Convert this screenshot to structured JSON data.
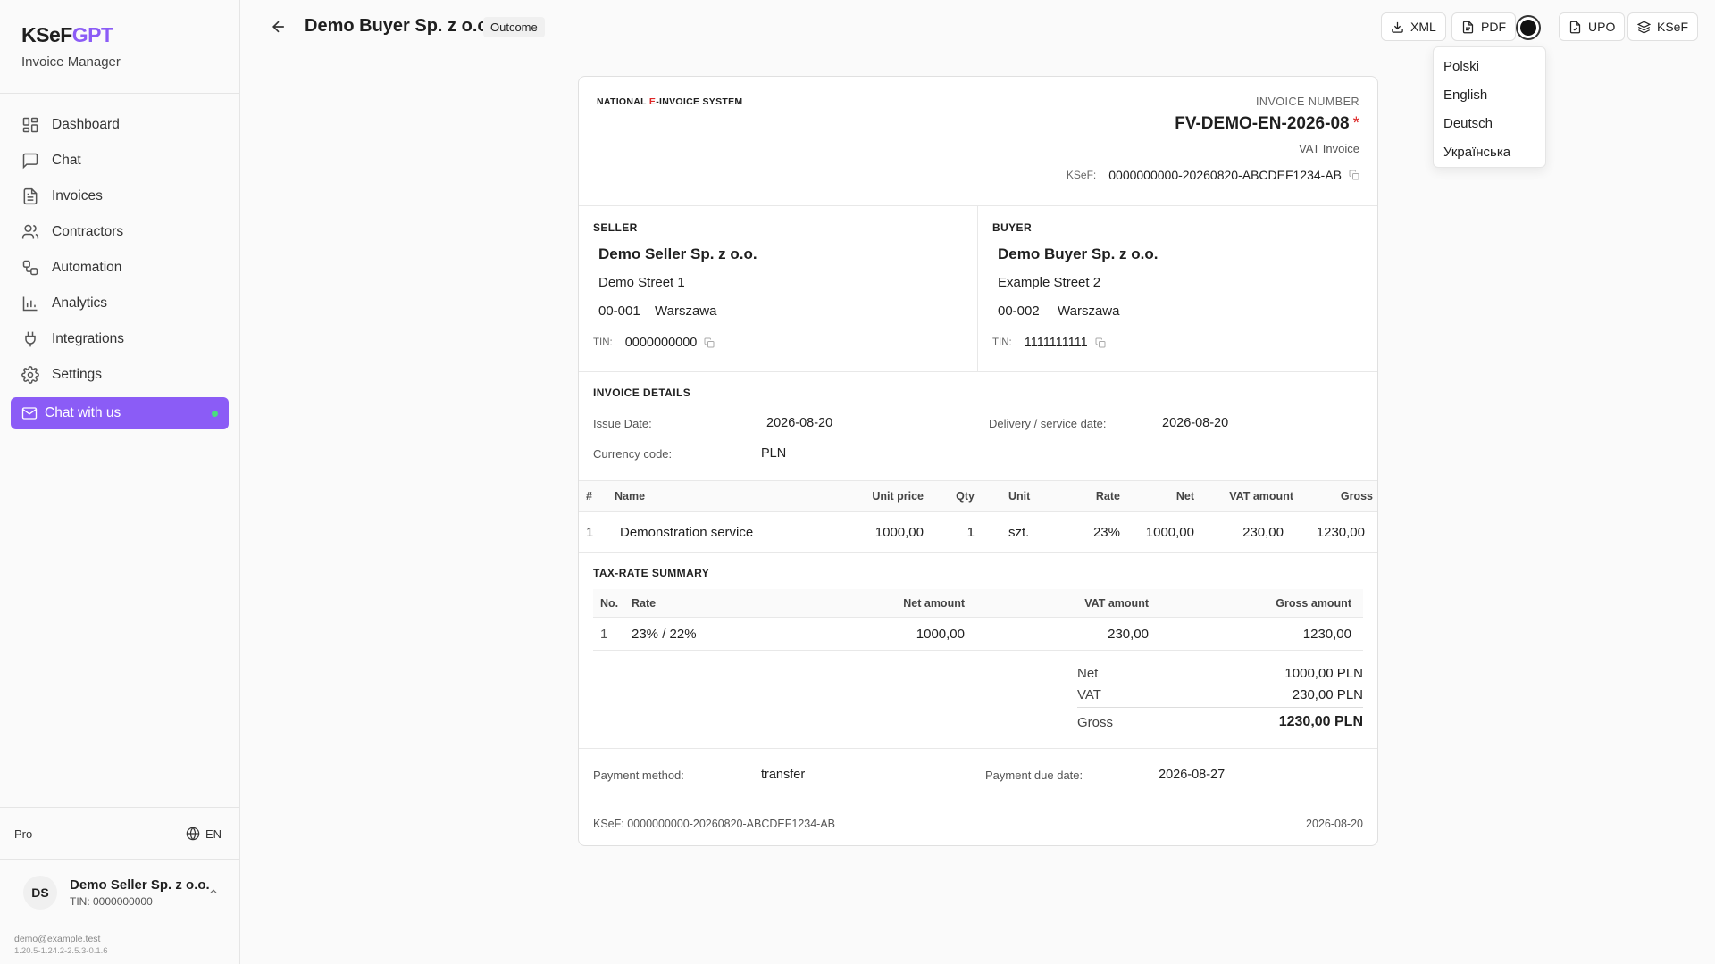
{
  "app": {
    "brand_main": "KSeF",
    "brand_accent": "GPT",
    "subtitle": "Invoice Manager"
  },
  "sidebar": {
    "items": [
      {
        "label": "Dashboard",
        "icon": "dashboard-icon"
      },
      {
        "label": "Chat",
        "icon": "chat-icon"
      },
      {
        "label": "Invoices",
        "icon": "invoice-icon"
      },
      {
        "label": "Contractors",
        "icon": "users-icon"
      },
      {
        "label": "Automation",
        "icon": "workflow-icon"
      },
      {
        "label": "Analytics",
        "icon": "bar-chart-icon"
      },
      {
        "label": "Integrations",
        "icon": "plug-icon"
      },
      {
        "label": "Settings",
        "icon": "gear-icon"
      }
    ],
    "chat_with_us": "Chat with us",
    "plan": "Pro",
    "language": "EN",
    "user": {
      "initials": "DS",
      "name": "Demo Seller Sp. z o.o.",
      "tin": "TIN: 0000000000"
    },
    "email": "demo@example.test",
    "version": "1.20.5-1.24.2-2.5.3-0.1.6"
  },
  "header": {
    "title": "Demo Buyer Sp. z o.o.",
    "badge": "Outcome",
    "buttons": {
      "xml": "XML",
      "pdf": "PDF",
      "upo": "UPO",
      "ksef": "KSeF"
    }
  },
  "language_menu": [
    "Polski",
    "English",
    "Deutsch",
    "Українська"
  ],
  "invoice": {
    "system_pre": "NATIONAL ",
    "system_red": "E",
    "system_post": "-INVOICE SYSTEM",
    "number_label": "INVOICE NUMBER",
    "number": "FV-DEMO-EN-2026-08",
    "required_mark": "*",
    "type": "VAT Invoice",
    "ksef_label": "KSeF:",
    "ksef_number": "0000000000-20260820-ABCDEF1234-AB",
    "seller": {
      "label": "SELLER",
      "name": "Demo Seller Sp. z o.o.",
      "street": "Demo Street 1",
      "postal": "00-001",
      "city": "Warszawa",
      "tin_label": "TIN:",
      "tin": "0000000000"
    },
    "buyer": {
      "label": "BUYER",
      "name": "Demo Buyer Sp. z o.o.",
      "street": "Example Street 2",
      "postal": "00-002",
      "city": "Warszawa",
      "tin_label": "TIN:",
      "tin": "1111111111"
    },
    "details": {
      "label": "INVOICE DETAILS",
      "issue_date_label": "Issue Date:",
      "issue_date": "2026-08-20",
      "delivery_label": "Delivery / service date:",
      "delivery_date": "2026-08-20",
      "currency_label": "Currency code:",
      "currency": "PLN"
    },
    "items_headers": {
      "no": "#",
      "name": "Name",
      "unit_price": "Unit price",
      "qty": "Qty",
      "unit": "Unit",
      "rate": "Rate",
      "net": "Net",
      "vat": "VAT amount",
      "gross": "Gross"
    },
    "items": [
      {
        "no": "1",
        "name": "Demonstration service",
        "unit_price": "1000,00",
        "qty": "1",
        "unit": "szt.",
        "rate": "23%",
        "net": "1000,00",
        "vat": "230,00",
        "gross": "1230,00"
      }
    ],
    "summary": {
      "label": "TAX-RATE SUMMARY",
      "headers": {
        "no": "No.",
        "rate": "Rate",
        "net": "Net amount",
        "vat": "VAT amount",
        "gross": "Gross amount"
      },
      "row": {
        "no": "1",
        "rate": "23% / 22%",
        "net": "1000,00",
        "vat": "230,00",
        "gross": "1230,00"
      }
    },
    "totals": {
      "net_label": "Net",
      "net": "1000,00 PLN",
      "vat_label": "VAT",
      "vat": "230,00 PLN",
      "gross_label": "Gross",
      "gross": "1230,00 PLN"
    },
    "payment": {
      "method_label": "Payment method:",
      "method": "transfer",
      "due_label": "Payment due date:",
      "due": "2026-08-27"
    },
    "footer": {
      "ksef": "KSeF: 0000000000-20260820-ABCDEF1234-AB",
      "date": "2026-08-20"
    }
  }
}
